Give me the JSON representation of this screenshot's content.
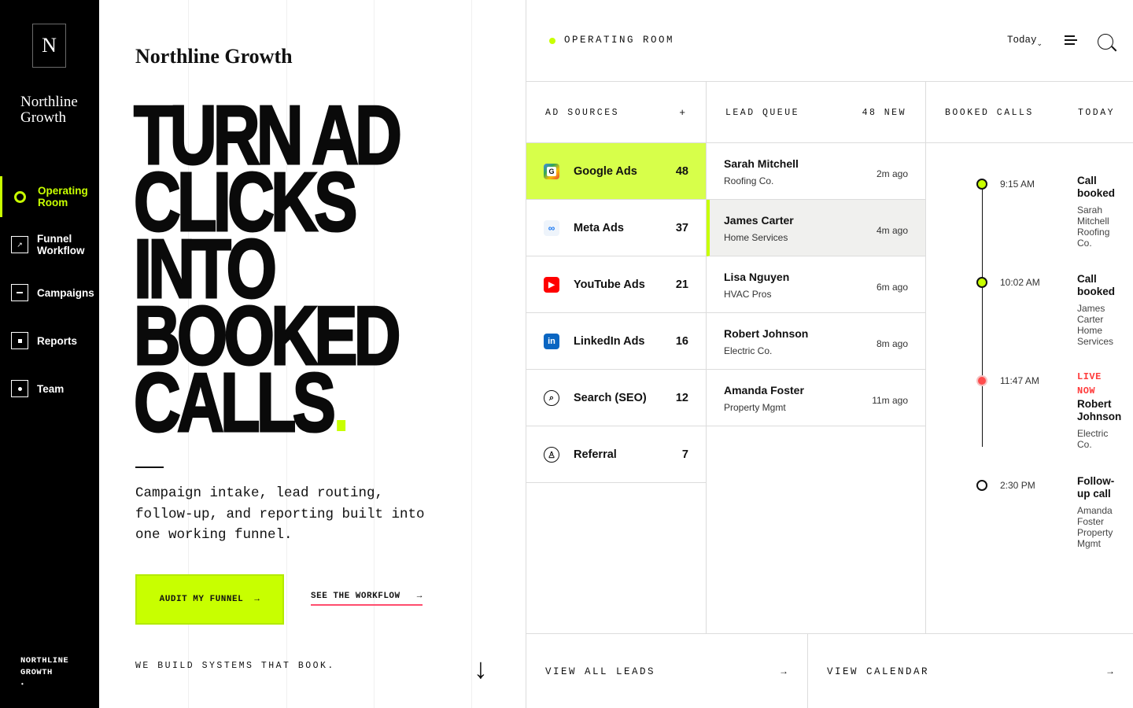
{
  "sidebar": {
    "logo_letter": "N",
    "brand_line1": "Northline",
    "brand_line2": "Growth",
    "items": [
      {
        "label_line1": "Operating",
        "label_line2": "Room",
        "icon": "target-icon"
      },
      {
        "label_line1": "Funnel",
        "label_line2": "Workflow",
        "icon": "arrow-icon"
      },
      {
        "label_line1": "Campaigns",
        "label_line2": "",
        "icon": "campaign-icon"
      },
      {
        "label_line1": "Reports",
        "label_line2": "",
        "icon": "report-icon"
      },
      {
        "label_line1": "Team",
        "label_line2": "",
        "icon": "team-icon"
      }
    ],
    "footer_line1": "NORTHLINE",
    "footer_line2": "GROWTH",
    "footer_dot": "•"
  },
  "hero": {
    "company": "Northline Growth",
    "headline": [
      "TURN AD",
      "CLICKS",
      "INTO",
      "BOOKED",
      "CALLS"
    ],
    "description": "Campaign intake, lead routing, follow-up, and reporting built into one working funnel.",
    "cta_label": "AUDIT MY FUNNEL",
    "cta_arrow": "→",
    "secondary_label": "SEE THE WORKFLOW",
    "secondary_arrow": "→",
    "tagline": "WE BUILD SYSTEMS THAT BOOK.",
    "scroll_arrow": "↓"
  },
  "panel": {
    "title": "OPERATING ROOM",
    "date_filter": "Today",
    "date_chevron": "⌄",
    "ad_sources": {
      "heading": "AD SOURCES",
      "add": "+",
      "items": [
        {
          "name": "Google Ads",
          "count": "48",
          "icon": "google-icon",
          "glyph": "G"
        },
        {
          "name": "Meta Ads",
          "count": "37",
          "icon": "meta-icon",
          "glyph": "∞"
        },
        {
          "name": "YouTube Ads",
          "count": "21",
          "icon": "youtube-icon",
          "glyph": "▶"
        },
        {
          "name": "LinkedIn Ads",
          "count": "16",
          "icon": "linkedin-icon",
          "glyph": "in"
        },
        {
          "name": "Search (SEO)",
          "count": "12",
          "icon": "search-seo-icon",
          "glyph": "⌕"
        },
        {
          "name": "Referral",
          "count": "7",
          "icon": "referral-icon",
          "glyph": "♙"
        }
      ]
    },
    "lead_queue": {
      "heading": "LEAD QUEUE",
      "new_count": "48 NEW",
      "items": [
        {
          "name": "Sarah Mitchell",
          "company": "Roofing Co.",
          "time": "2m ago"
        },
        {
          "name": "James Carter",
          "company": "Home Services",
          "time": "4m ago"
        },
        {
          "name": "Lisa Nguyen",
          "company": "HVAC Pros",
          "time": "6m ago"
        },
        {
          "name": "Robert Johnson",
          "company": "Electric Co.",
          "time": "8m ago"
        },
        {
          "name": "Amanda Foster",
          "company": "Property Mgmt",
          "time": "11m ago"
        }
      ]
    },
    "booked_calls": {
      "heading": "BOOKED CALLS",
      "period": "TODAY",
      "items": [
        {
          "time": "9:15 AM",
          "status_line1": "Call",
          "status_line2": "booked",
          "detail": [
            "Sarah",
            "Mitchell",
            "Roofing",
            "Co."
          ]
        },
        {
          "time": "10:02 AM",
          "status_line1": "Call",
          "status_line2": "booked",
          "detail": [
            "James",
            "Carter",
            "Home",
            "Services"
          ]
        },
        {
          "time": "11:47 AM",
          "live_line1": "LIVE",
          "live_line2": "NOW",
          "status_line1": "Robert",
          "status_line2": "Johnson",
          "detail": [
            "Electric",
            "Co."
          ]
        },
        {
          "time": "2:30 PM",
          "status_line1": "Follow-",
          "status_line2": "up call",
          "detail": [
            "Amanda",
            "Foster",
            "Property",
            "Mgmt"
          ]
        }
      ]
    },
    "view_leads": "VIEW ALL LEADS",
    "view_calendar": "VIEW CALENDAR",
    "arrow": "→"
  },
  "colors": {
    "accent": "#c8ff00",
    "live": "#ff3b3b",
    "underline": "#ff4d6d"
  }
}
